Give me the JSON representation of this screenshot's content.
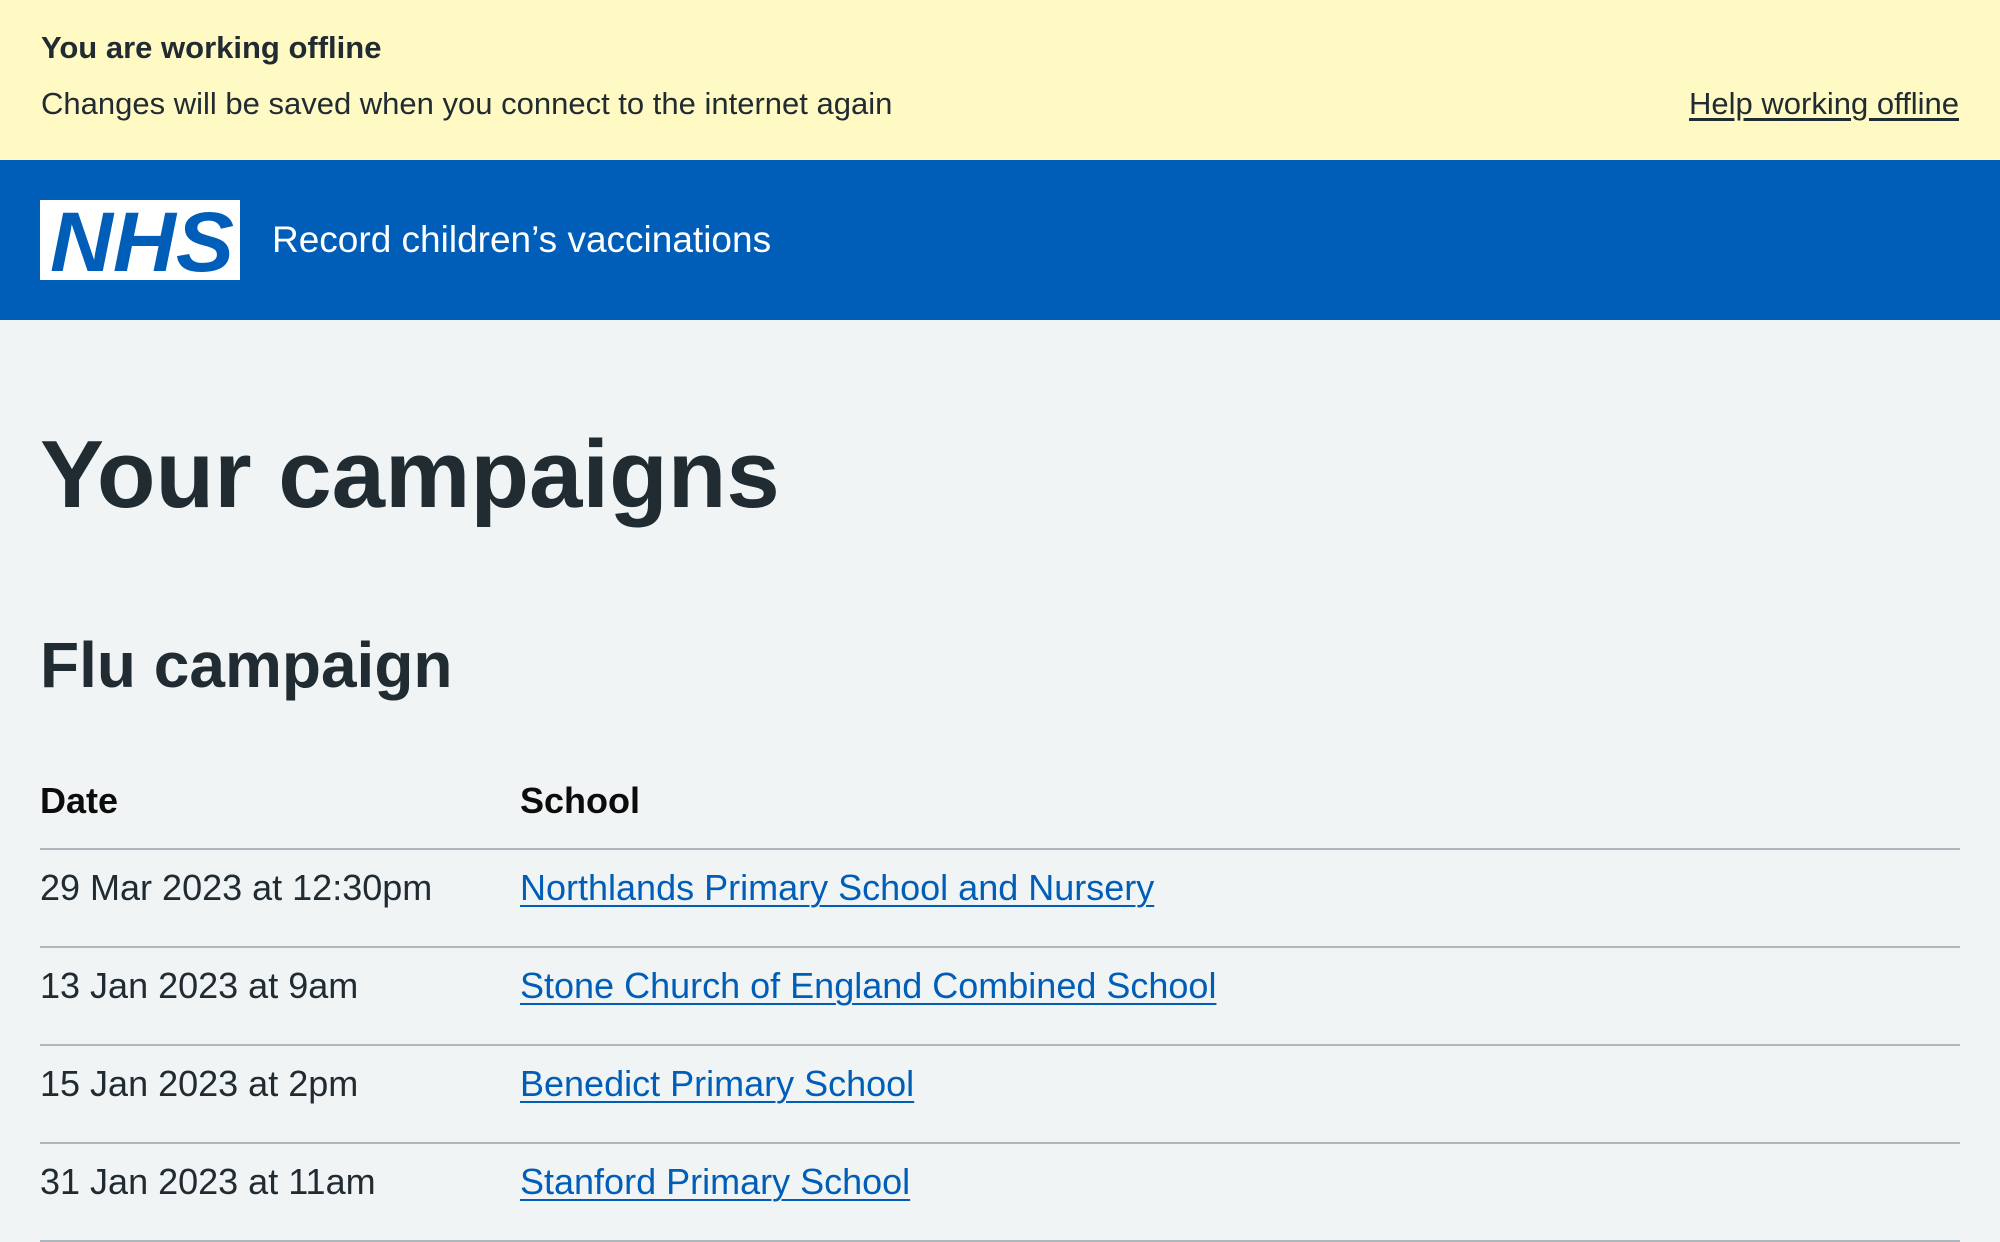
{
  "offline_banner": {
    "title": "You are working offline",
    "message": "Changes will be saved when you connect to the internet again",
    "help_link": "Help working offline"
  },
  "header": {
    "logo_text": "NHS",
    "service_name": "Record children’s vaccinations"
  },
  "page": {
    "title": "Your campaigns"
  },
  "campaign": {
    "title": "Flu campaign",
    "table": {
      "headers": {
        "date": "Date",
        "school": "School"
      },
      "rows": [
        {
          "date": "29 Mar 2023 at 12:30pm",
          "school": "Northlands Primary School and Nursery"
        },
        {
          "date": "13 Jan 2023 at 9am",
          "school": "Stone Church of England Combined School"
        },
        {
          "date": "15 Jan 2023 at 2pm",
          "school": "Benedict Primary School"
        },
        {
          "date": "31 Jan 2023 at 11am",
          "school": "Stanford Primary School"
        }
      ]
    }
  },
  "colors": {
    "banner_background": "#fff9c4",
    "header_background": "#005eb8",
    "page_background": "#f0f4f5",
    "link": "#005eb8",
    "text": "#212b32"
  }
}
